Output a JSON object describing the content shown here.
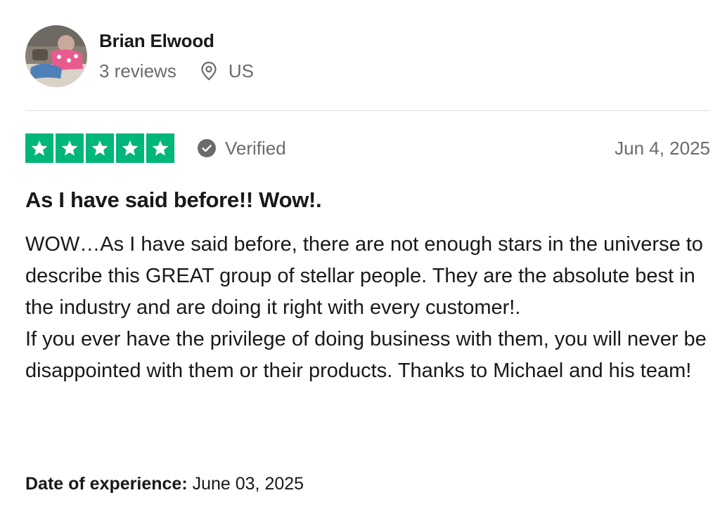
{
  "reviewer": {
    "name": "Brian Elwood",
    "review_count": "3 reviews",
    "location": "US",
    "avatar_icon": "user-photo-avatar",
    "location_icon": "map-pin-icon"
  },
  "rating": {
    "stars": 5,
    "max_stars": 5,
    "star_color": "#00b67a",
    "verified_label": "Verified",
    "verified_icon": "check-circle-icon",
    "date": "Jun 4, 2025"
  },
  "review": {
    "title": "As I have said before!! Wow!.",
    "paragraphs": [
      "WOW…As I have said before, there are not enough stars in the universe to describe this GREAT group of stellar people. They are the absolute best in the industry and are doing it right with every customer!.",
      "If you ever have the privilege of doing business with them, you will never be disappointed with them or their products. Thanks to Michael and his team!"
    ],
    "experience_label": "Date of experience:",
    "experience_date": "June 03, 2025"
  }
}
